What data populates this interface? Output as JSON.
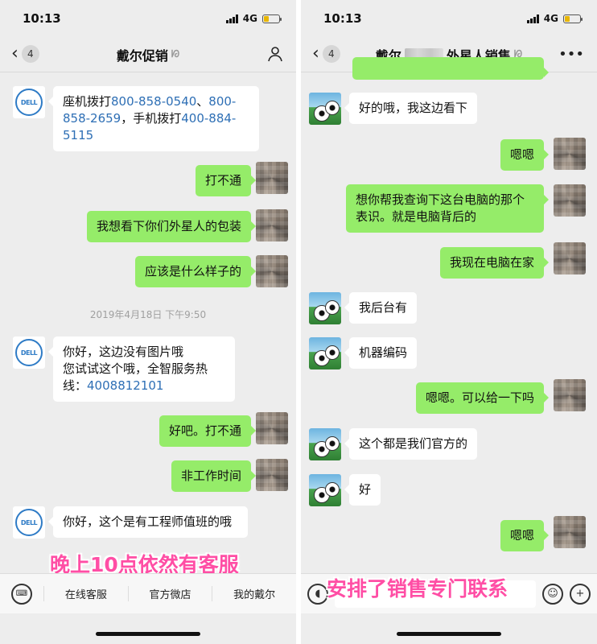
{
  "left": {
    "status": {
      "time": "10:13",
      "network": "4G"
    },
    "nav": {
      "back_count": "4",
      "title": "戴尔促销"
    },
    "messages": {
      "m1_part1": "座机拨打",
      "m1_link1": "800-858-0540",
      "m1_sep1": "、",
      "m1_link2": "800-858-2659",
      "m1_part2": "，手机拨打",
      "m1_link3": "400-884-5115",
      "m2": "打不通",
      "m3": "我想看下你们外星人的包装",
      "m4": "应该是什么样子的",
      "timestamp": "2019年4月18日 下午9:50",
      "m5_text": "你好，这边没有图片哦\n您试试这个哦，全智服务热线：",
      "m5_link": "4008812101",
      "m6": "好吧。打不通",
      "m7": "非工作时间",
      "m8": "你好，这个是有工程师值班的哦"
    },
    "caption": "晚上10点依然有客服",
    "menu": {
      "item1": "在线客服",
      "item2": "官方微店",
      "item3": "我的戴尔"
    }
  },
  "right": {
    "status": {
      "time": "10:13",
      "network": "4G"
    },
    "nav": {
      "back_count": "4",
      "title_prefix": "戴尔",
      "title_suffix": "外星人销售"
    },
    "messages": {
      "r1": "好的哦，我这边看下",
      "r2": "嗯嗯",
      "r3": "想你帮我查询下这台电脑的那个表识。就是电脑背后的",
      "r4": "我现在电脑在家",
      "r5": "我后台有",
      "r6": "机器编码",
      "r7": "嗯嗯。可以给一下吗",
      "r8": "这个都是我们官方的",
      "r9": "好",
      "r10": "嗯嗯"
    },
    "caption": "安排了销售专门联系"
  },
  "colors": {
    "accent_green": "#95ec69",
    "link_blue": "#2e6fb5",
    "caption_pink": "#ff4ea5",
    "dell_blue": "#2e7bc6"
  },
  "icons": [
    "back-chevron-icon",
    "person-icon",
    "more-icon",
    "keyboard-icon",
    "voice-icon",
    "emoji-icon",
    "plus-icon",
    "dell-logo-icon",
    "ear-icon"
  ]
}
